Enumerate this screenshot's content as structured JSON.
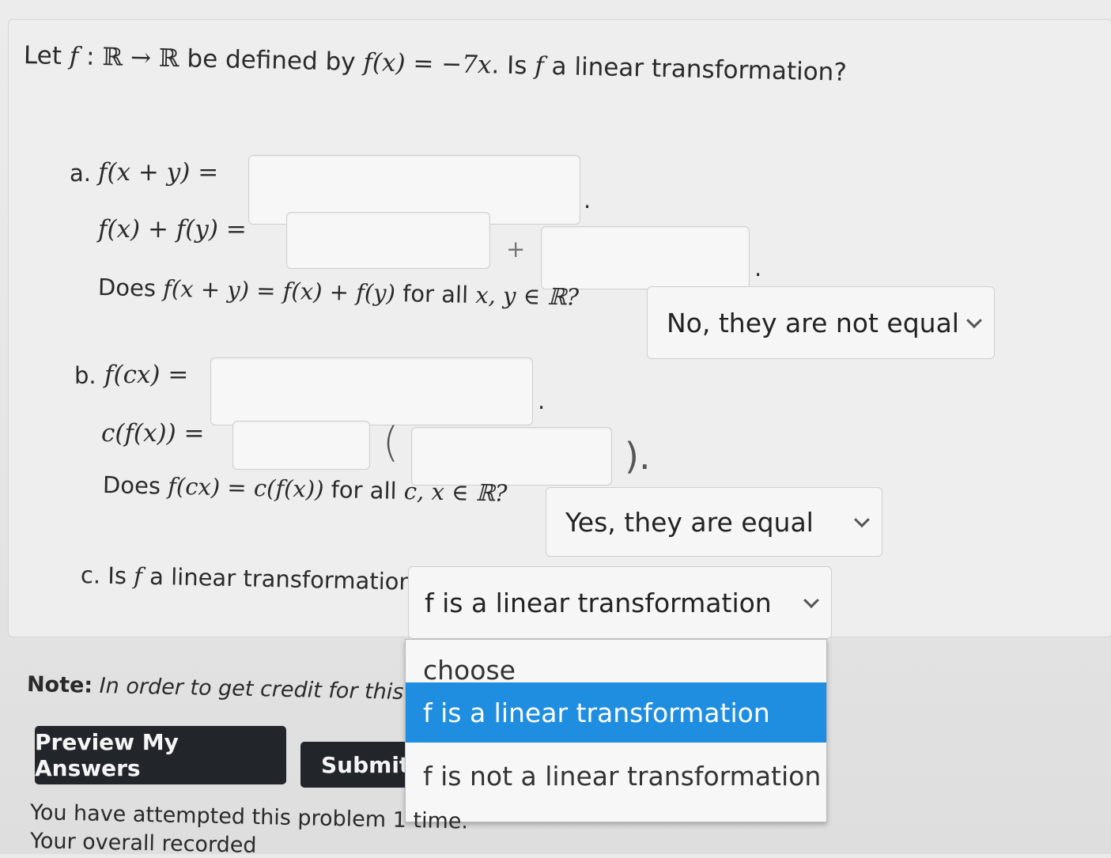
{
  "question": {
    "intro": "Let ",
    "f": "f",
    "colon": " : ",
    "domain": "ℝ → ℝ",
    "defined": " be defined by ",
    "fx": "f(x) = −7x",
    "tail": ". Is ",
    "f2": "f",
    "tail2": " a linear transformation?"
  },
  "part_a": {
    "label": "a.",
    "line1_expr": "f(x + y) =",
    "line1_end": ".",
    "line2_expr": "f(x) + f(y) =",
    "plus": "+",
    "line2_end": ".",
    "q_prefix": "Does ",
    "q_expr": "f(x + y) = f(x) + f(y)",
    "q_mid": " for all ",
    "q_vars": "x, y ∈ ℝ?",
    "select_value": "No, they are not equal"
  },
  "part_b": {
    "label": "b.",
    "line1_expr": "f(cx) =",
    "line1_end": ".",
    "line2_expr": "c(f(x)) =",
    "open_paren": "(",
    "close_paren": ").",
    "q_prefix": "Does ",
    "q_expr": "f(cx) = c(f(x))",
    "q_mid": " for all ",
    "q_vars": "c, x ∈ ℝ?",
    "select_value": "Yes, they are equal"
  },
  "part_c": {
    "label": "c. Is ",
    "f": "f",
    "rest": " a linear transformation?",
    "select_value": "f is a linear transformation",
    "options": [
      "choose",
      "f is a linear transformation",
      "f is not a linear transformation"
    ]
  },
  "note": {
    "label": "Note:",
    "text": " In order to get credit for this pr"
  },
  "buttons": {
    "preview": "Preview My Answers",
    "submit": "Submit"
  },
  "status": {
    "attempted": "You have attempted this problem 1 time.",
    "overall": "Your overall recorded"
  }
}
